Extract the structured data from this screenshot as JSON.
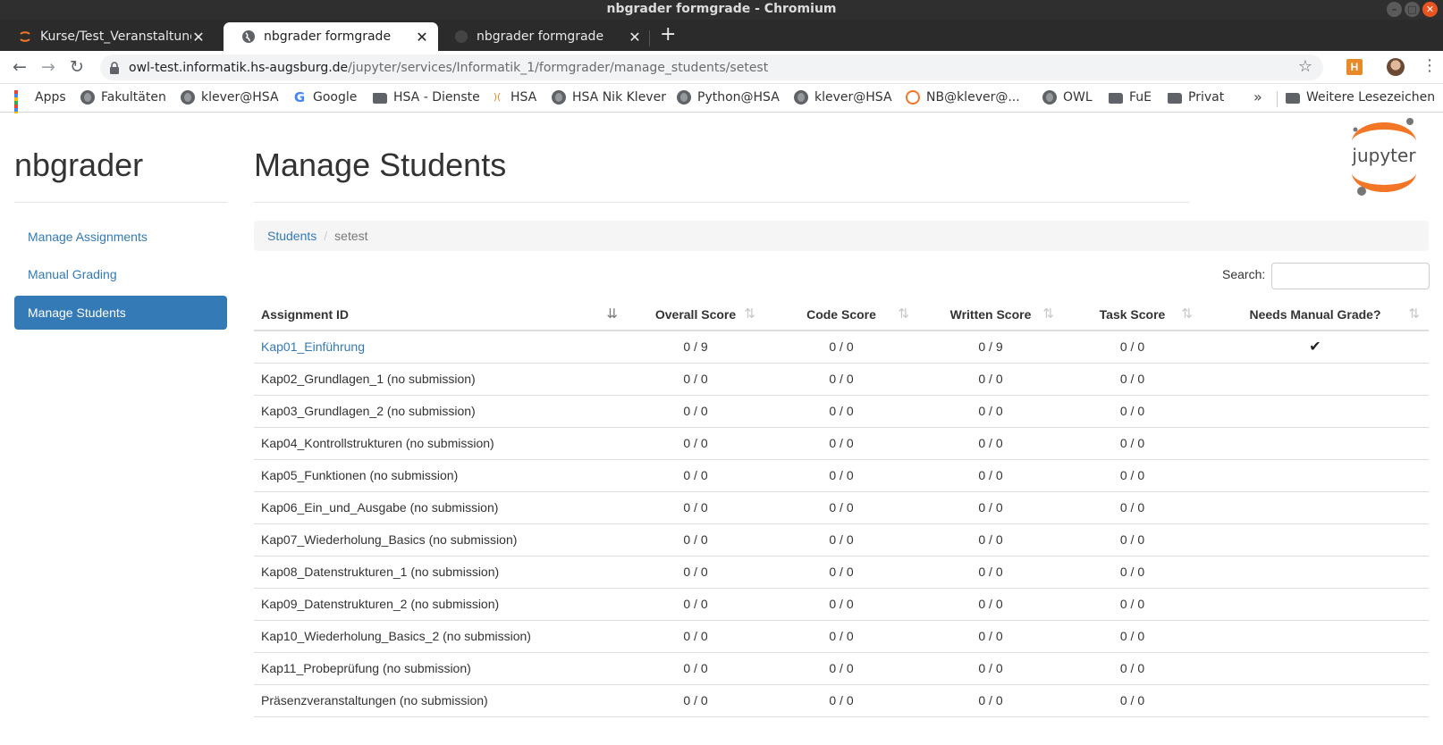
{
  "window": {
    "title": "nbgrader formgrade - Chromium",
    "buttons": [
      "–",
      "□",
      "✕"
    ]
  },
  "tabs": [
    {
      "title": "Kurse/Test_Veranstaltung",
      "close": "✕",
      "active": false
    },
    {
      "title": "nbgrader formgrade",
      "close": "✕",
      "active": true
    },
    {
      "title": "nbgrader formgrade",
      "close": "✕",
      "active": false
    }
  ],
  "new_tab_label": "+",
  "toolbar": {
    "back_icon": "←",
    "forward_icon": "→",
    "reload_icon": "↻",
    "url_host": "owl-test.informatik.hs-augsburg.de",
    "url_path": "/jupyter/services/Informatik_1/formgrader/manage_students/setest",
    "star_icon": "☆",
    "extension_label": "H",
    "menu_icon": "⋮"
  },
  "bookmarks": [
    {
      "label": "Apps",
      "icon": "apps-icon"
    },
    {
      "label": "Fakultäten",
      "icon": "globe-icon"
    },
    {
      "label": "klever@HSA",
      "icon": "globe-icon"
    },
    {
      "label": "Google",
      "icon": "google-icon"
    },
    {
      "label": "HSA - Dienste",
      "icon": "folder-icon"
    },
    {
      "label": "HSA",
      "icon": "hsa-icon"
    },
    {
      "label": "HSA Nik Klever",
      "icon": "globe-icon"
    },
    {
      "label": "Python@HSA",
      "icon": "globe-icon"
    },
    {
      "label": "klever@HSA",
      "icon": "globe-icon"
    },
    {
      "label": "NB@klever@...",
      "icon": "jupyter-icon"
    },
    {
      "label": "OWL",
      "icon": "globe-icon"
    },
    {
      "label": "FuE",
      "icon": "folder-icon"
    },
    {
      "label": "Privat",
      "icon": "folder-icon"
    },
    {
      "label": "Weitere Lesezeichen",
      "icon": "folder-icon"
    }
  ],
  "bookmarks_more": "»",
  "sidebar": {
    "brand": "nbgrader",
    "items": [
      {
        "label": "Manage Assignments",
        "active": false
      },
      {
        "label": "Manual Grading",
        "active": false
      },
      {
        "label": "Manage Students",
        "active": true
      }
    ]
  },
  "main": {
    "title": "Manage Students",
    "logo_text": "jupyter",
    "breadcrumb": {
      "root": "Students",
      "separator": "/",
      "current": "setest"
    },
    "search_label": "Search:",
    "search_value": "",
    "table": {
      "columns": [
        "Assignment ID",
        "Overall Score",
        "Code Score",
        "Written Score",
        "Task Score",
        "Needs Manual Grade?"
      ],
      "sort_icon": "⇅",
      "sorted_icon": "⇊",
      "rows": [
        {
          "id": "Kap01_Einführung",
          "note": "",
          "overall": "0 / 9",
          "code": "0 / 0",
          "written": "0 / 9",
          "task": "0 / 0",
          "manual": "✔",
          "link": true
        },
        {
          "id": "Kap02_Grundlagen_1",
          "note": "(no submission)",
          "overall": "0 / 0",
          "code": "0 / 0",
          "written": "0 / 0",
          "task": "0 / 0",
          "manual": "",
          "link": false
        },
        {
          "id": "Kap03_Grundlagen_2",
          "note": "(no submission)",
          "overall": "0 / 0",
          "code": "0 / 0",
          "written": "0 / 0",
          "task": "0 / 0",
          "manual": "",
          "link": false
        },
        {
          "id": "Kap04_Kontrollstrukturen",
          "note": "(no submission)",
          "overall": "0 / 0",
          "code": "0 / 0",
          "written": "0 / 0",
          "task": "0 / 0",
          "manual": "",
          "link": false
        },
        {
          "id": "Kap05_Funktionen",
          "note": "(no submission)",
          "overall": "0 / 0",
          "code": "0 / 0",
          "written": "0 / 0",
          "task": "0 / 0",
          "manual": "",
          "link": false
        },
        {
          "id": "Kap06_Ein_und_Ausgabe",
          "note": "(no submission)",
          "overall": "0 / 0",
          "code": "0 / 0",
          "written": "0 / 0",
          "task": "0 / 0",
          "manual": "",
          "link": false
        },
        {
          "id": "Kap07_Wiederholung_Basics",
          "note": "(no submission)",
          "overall": "0 / 0",
          "code": "0 / 0",
          "written": "0 / 0",
          "task": "0 / 0",
          "manual": "",
          "link": false
        },
        {
          "id": "Kap08_Datenstrukturen_1",
          "note": "(no submission)",
          "overall": "0 / 0",
          "code": "0 / 0",
          "written": "0 / 0",
          "task": "0 / 0",
          "manual": "",
          "link": false
        },
        {
          "id": "Kap09_Datenstrukturen_2",
          "note": "(no submission)",
          "overall": "0 / 0",
          "code": "0 / 0",
          "written": "0 / 0",
          "task": "0 / 0",
          "manual": "",
          "link": false
        },
        {
          "id": "Kap10_Wiederholung_Basics_2",
          "note": "(no submission)",
          "overall": "0 / 0",
          "code": "0 / 0",
          "written": "0 / 0",
          "task": "0 / 0",
          "manual": "",
          "link": false
        },
        {
          "id": "Kap11_Probeprüfung",
          "note": "(no submission)",
          "overall": "0 / 0",
          "code": "0 / 0",
          "written": "0 / 0",
          "task": "0 / 0",
          "manual": "",
          "link": false
        },
        {
          "id": "Präsenzveranstaltungen",
          "note": "(no submission)",
          "overall": "0 / 0",
          "code": "0 / 0",
          "written": "0 / 0",
          "task": "0 / 0",
          "manual": "",
          "link": false
        }
      ]
    }
  },
  "colors": {
    "link": "#337ab7",
    "active_nav": "#337ab7",
    "jupyter_orange": "#f37626",
    "ubuntu_orange": "#e95420"
  }
}
